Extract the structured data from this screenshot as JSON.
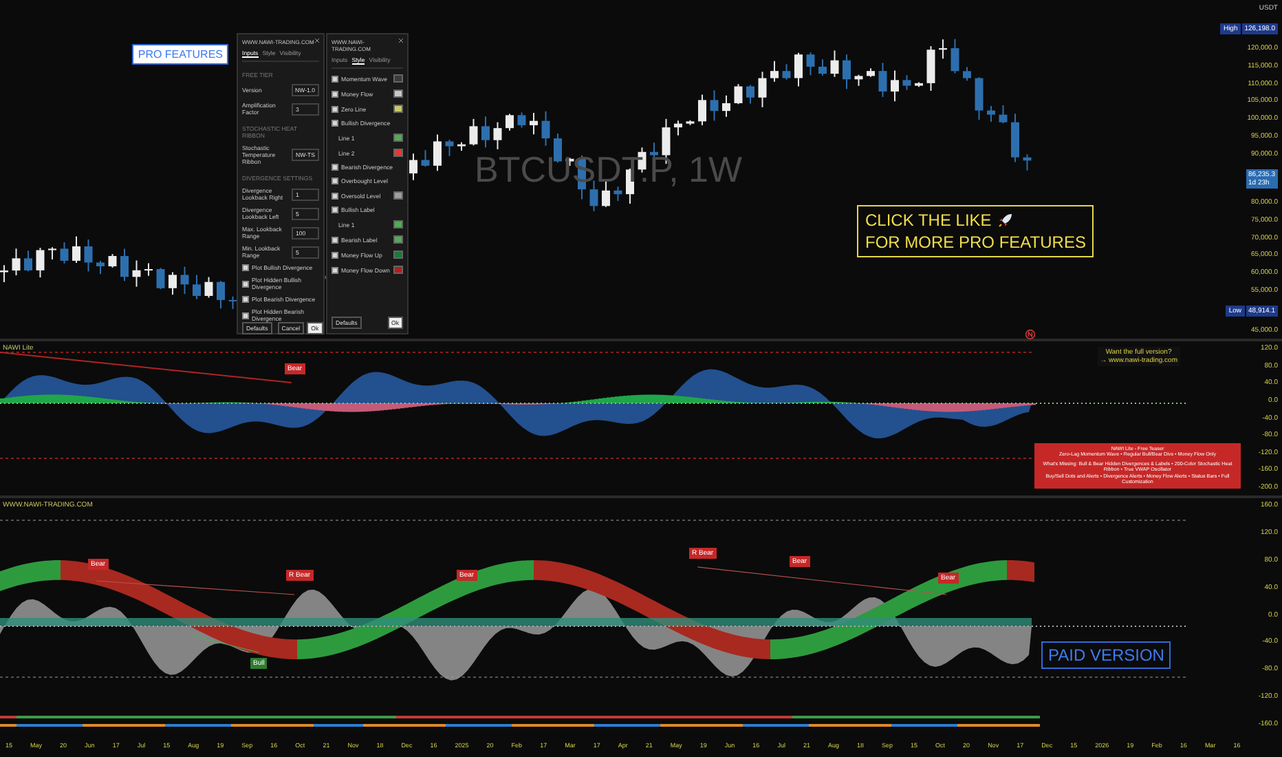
{
  "main_chart": {
    "symbol_watermark": "BTCUSDT.P, 1W",
    "promo_label": "PRO FEATURES",
    "like_banner": [
      "CLICK THE LIKE",
      "FOR MORE PRO FEATURES"
    ],
    "price_axis": {
      "unit": "USDT",
      "ticks": [
        {
          "kind": "high",
          "tag": "High",
          "value": "126,198.0"
        },
        {
          "kind": "tick",
          "value": "120,000.0"
        },
        {
          "kind": "tick",
          "value": "115,000.0"
        },
        {
          "kind": "tick",
          "value": "110,000.0"
        },
        {
          "kind": "tick",
          "value": "105,000.0"
        },
        {
          "kind": "tick",
          "value": "100,000.0"
        },
        {
          "kind": "tick",
          "value": "95,000.0"
        },
        {
          "kind": "tick",
          "value": "90,000.0"
        },
        {
          "kind": "last",
          "value": "86,235.3",
          "tag": "1d 23h"
        },
        {
          "kind": "tick",
          "value": "80,000.0"
        },
        {
          "kind": "tick",
          "value": "75,000.0"
        },
        {
          "kind": "tick",
          "value": "70,000.0"
        },
        {
          "kind": "tick",
          "value": "65,000.0"
        },
        {
          "kind": "tick",
          "value": "60,000.0"
        },
        {
          "kind": "tick",
          "value": "55,000.0"
        },
        {
          "kind": "low",
          "tag": "Low",
          "value": "48,914.1"
        },
        {
          "kind": "tick",
          "value": "45,000.0"
        }
      ]
    }
  },
  "settings_dialog": {
    "title": "WWW.NAWI-TRADING.COM",
    "tabs": [
      {
        "label": "Inputs",
        "selected": true
      },
      {
        "label": "Style",
        "selected": false
      },
      {
        "label": "Visibility",
        "selected": false
      }
    ],
    "rows": [
      {
        "kind": "section",
        "label": "FREE TIER"
      },
      {
        "kind": "select",
        "label": "Version",
        "value": "NW-1.0"
      },
      {
        "kind": "number",
        "label": "Amplification Factor",
        "value": "3"
      },
      {
        "kind": "section",
        "label": "STOCHASTIC HEAT RIBBON"
      },
      {
        "kind": "select",
        "label": "Stochastic Temperature Ribbon",
        "value": "NW-TS"
      },
      {
        "kind": "section",
        "label": "DIVERGENCE SETTINGS"
      },
      {
        "kind": "number",
        "label": "Divergence Lookback Right",
        "value": "1"
      },
      {
        "kind": "number",
        "label": "Divergence Lookback Left",
        "value": "5"
      },
      {
        "kind": "number",
        "label": "Max. Lookback Range",
        "value": "100"
      },
      {
        "kind": "number",
        "label": "Min. Lookback Range",
        "value": "5"
      },
      {
        "kind": "check",
        "label": "Plot Bullish Divergence",
        "checked": true
      },
      {
        "kind": "check",
        "label": "Plot Hidden Bullish Divergence",
        "checked": true
      },
      {
        "kind": "check",
        "label": "Plot Bearish Divergence",
        "checked": true
      },
      {
        "kind": "check",
        "label": "Plot Hidden Bearish Divergence",
        "checked": true
      }
    ],
    "buttons": {
      "defaults": "Defaults",
      "cancel": "Cancel",
      "ok": "Ok"
    }
  },
  "style_panel": {
    "title": "WWW.NAWI-TRADING.COM",
    "tabs": [
      {
        "label": "Inputs",
        "selected": false
      },
      {
        "label": "Style",
        "selected": true
      },
      {
        "label": "Visibility",
        "selected": false
      }
    ],
    "rows": [
      {
        "kind": "check",
        "label": "Momentum Wave",
        "checked": true,
        "color": "#3a3a3a"
      },
      {
        "kind": "check",
        "label": "Money Flow",
        "checked": true,
        "color": "#c8c8c8"
      },
      {
        "kind": "check",
        "label": "Zero Line",
        "checked": true,
        "color": "#c9c96a"
      },
      {
        "kind": "check",
        "label": "Bullish Divergence",
        "checked": true
      },
      {
        "kind": "sub",
        "label": "Line 1",
        "color": "#4caf50"
      },
      {
        "kind": "sub",
        "label": "Line 2",
        "color": "#e53935"
      },
      {
        "kind": "check",
        "label": "Bearish Divergence",
        "checked": true
      },
      {
        "kind": "check",
        "label": "Overbought Level",
        "checked": true
      },
      {
        "kind": "check",
        "label": "Oversold Level",
        "checked": true,
        "color": "#9e9e9e"
      },
      {
        "kind": "check",
        "label": "Bullish Label",
        "checked": true
      },
      {
        "kind": "sub",
        "label": "Line 1",
        "color": "#4caf50"
      },
      {
        "kind": "check",
        "label": "Bearish Label",
        "checked": true,
        "color": "#4caf50"
      },
      {
        "kind": "check",
        "label": "Money Flow Up",
        "checked": true,
        "color": "#1b7a3a"
      },
      {
        "kind": "check",
        "label": "Money Flow Down",
        "checked": true,
        "color": "#b71c1c"
      }
    ],
    "buttons": {
      "defaults": "Defaults",
      "ok": "Ok"
    }
  },
  "oscillator_lite": {
    "title": "NAWI Lite",
    "signal": "Bear",
    "promo": [
      "Want the full version?",
      "→ www.nawi-trading.com"
    ],
    "info_box": {
      "title": "NAWI Lite - Free Teaser",
      "features": "Zero-Lag Momentum Wave • Regular Bull/Bear Divs • Money Flow Only",
      "missing": "What's Missing: Bull & Bear Hidden Divergences & Labels • 200-Color Stochastic Heat Ribbon • True VWAP Oscillator",
      "missing_more": "Buy/Sell Dots and Alerts • Divergence Alerts • Money Flow Alerts • Status Bars • Full Customization"
    },
    "axis": [
      "120.0",
      "80.0",
      "40.0",
      "0.0",
      "-40.0",
      "-80.0",
      "-120.0",
      "-160.0",
      "-200.0"
    ]
  },
  "oscillator_pro": {
    "title": "WWW.NAWI-TRADING.COM",
    "signals": [
      {
        "label": "Bear",
        "kind": "bear"
      },
      {
        "label": "Bull",
        "kind": "bull"
      },
      {
        "label": "R Bear",
        "kind": "bear"
      },
      {
        "label": "Bear",
        "kind": "bear"
      },
      {
        "label": "R Bear",
        "kind": "bear"
      },
      {
        "label": "Bear",
        "kind": "bear"
      },
      {
        "label": "Bear",
        "kind": "bear"
      }
    ],
    "badge": "PAID VERSION",
    "axis": [
      "160.0",
      "120.0",
      "80.0",
      "40.0",
      "0.0",
      "-40.0",
      "-80.0",
      "-120.0",
      "-160.0"
    ]
  },
  "time_axis": [
    "15",
    "May",
    "20",
    "Jun",
    "17",
    "Jul",
    "15",
    "Aug",
    "19",
    "Sep",
    "16",
    "Oct",
    "21",
    "Nov",
    "18",
    "Dec",
    "16",
    "2025",
    "20",
    "Feb",
    "17",
    "Mar",
    "17",
    "Apr",
    "21",
    "May",
    "19",
    "Jun",
    "16",
    "Jul",
    "21",
    "Aug",
    "18",
    "Sep",
    "15",
    "Oct",
    "20",
    "Nov",
    "17",
    "Dec",
    "15",
    "2026",
    "19",
    "Feb",
    "16",
    "Mar",
    "16"
  ]
}
